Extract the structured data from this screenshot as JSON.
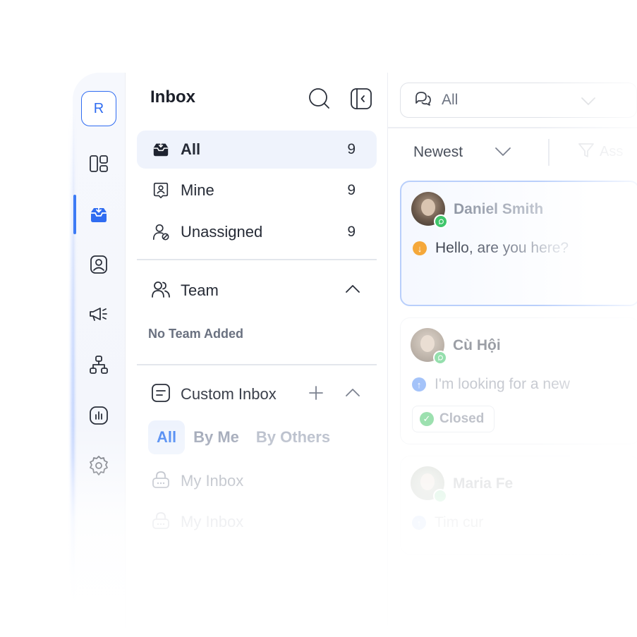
{
  "workspace": {
    "initial": "R"
  },
  "rail": {
    "items": [
      {
        "name": "dashboard-icon"
      },
      {
        "name": "inbox-icon",
        "active": true
      },
      {
        "name": "contacts-icon"
      },
      {
        "name": "broadcast-icon"
      },
      {
        "name": "workflow-icon"
      },
      {
        "name": "reports-icon"
      },
      {
        "name": "settings-icon"
      }
    ],
    "accent": "#3d7bf5"
  },
  "inbox": {
    "title": "Inbox",
    "nav": [
      {
        "label": "All",
        "count": "9",
        "active": true
      },
      {
        "label": "Mine",
        "count": "9"
      },
      {
        "label": "Unassigned",
        "count": "9"
      }
    ],
    "team": {
      "label": "Team",
      "empty": "No Team Added"
    },
    "custom": {
      "label": "Custom Inbox",
      "tabs": [
        "All",
        "By Me",
        "By Others"
      ],
      "items": [
        "My Inbox",
        "My Inbox"
      ]
    }
  },
  "conversations": {
    "filter": "All",
    "sort": "Newest",
    "assign_partial": "Ass",
    "cards": [
      {
        "name": "Daniel Smith",
        "message": "Hello, are you here?",
        "direction": "incoming",
        "channel": "whatsapp"
      },
      {
        "name": "Cù Hội",
        "message": "I'm looking for a new",
        "direction": "outgoing",
        "channel": "whatsapp",
        "status": "Closed"
      },
      {
        "name": "Maria Fe",
        "message": "Tim cur",
        "direction": "outgoing",
        "channel": "whatsapp"
      }
    ],
    "colors": {
      "incoming": "#f5a83a",
      "outgoing": "#5b93f5",
      "closed": "#4cc76e"
    }
  }
}
